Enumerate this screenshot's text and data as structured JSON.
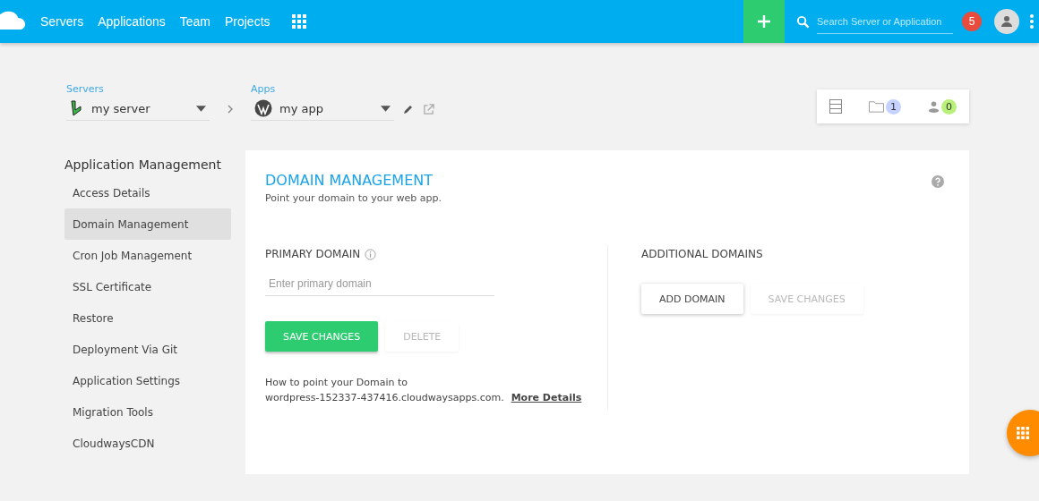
{
  "nav": {
    "items": [
      "Servers",
      "Applications",
      "Team",
      "Projects"
    ]
  },
  "search": {
    "placeholder": "Search Server or Application"
  },
  "notifications": {
    "count": "5"
  },
  "breadcrumb": {
    "server_label": "Servers",
    "server": "my server",
    "app_label": "Apps",
    "app": "my app"
  },
  "counters": {
    "projects": "1",
    "team": "0"
  },
  "sidebar": {
    "title": "Application Management",
    "items": [
      {
        "label": "Access Details",
        "selected": false
      },
      {
        "label": "Domain Management",
        "selected": true
      },
      {
        "label": "Cron Job Management",
        "selected": false
      },
      {
        "label": "SSL Certificate",
        "selected": false
      },
      {
        "label": "Restore",
        "selected": false
      },
      {
        "label": "Deployment Via Git",
        "selected": false
      },
      {
        "label": "Application Settings",
        "selected": false
      },
      {
        "label": "Migration Tools",
        "selected": false
      },
      {
        "label": "CloudwaysCDN",
        "selected": false
      }
    ]
  },
  "panel": {
    "title": "DOMAIN MANAGEMENT",
    "subtitle": "Point your domain to your web app.",
    "primary": {
      "heading": "PRIMARY DOMAIN",
      "placeholder": "Enter primary domain",
      "buttons": [
        {
          "label": "SAVE CHANGES",
          "kind": "primary",
          "disabled": false
        },
        {
          "label": "DELETE",
          "kind": "plain",
          "disabled": true
        }
      ],
      "help": "How to point your Domain to",
      "host": "wordpress-152337-437416.cloudwaysapps.com.",
      "link": "More Details"
    },
    "additional": {
      "heading": "ADDITIONAL DOMAINS",
      "buttons": [
        {
          "label": "ADD DOMAIN",
          "kind": "plain",
          "disabled": false
        },
        {
          "label": "SAVE CHANGES",
          "kind": "plain",
          "disabled": true
        }
      ]
    }
  }
}
